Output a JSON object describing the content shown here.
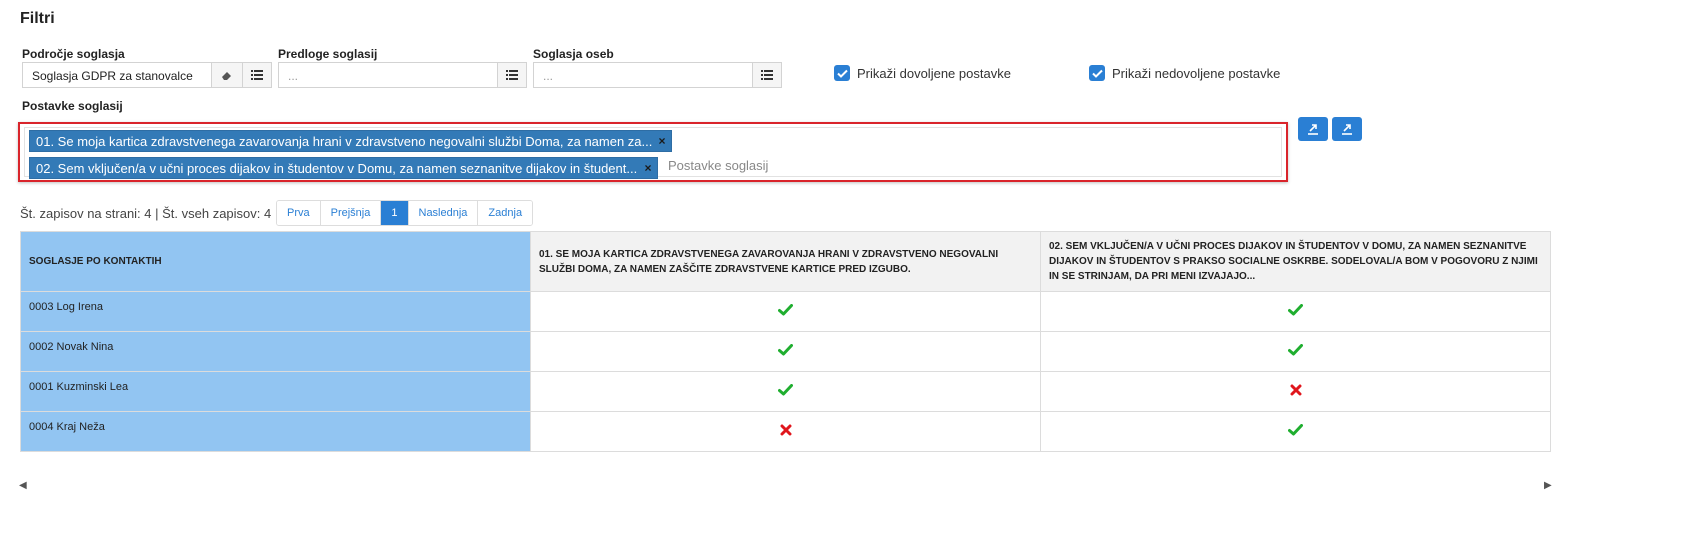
{
  "page_title": "Filtri",
  "filters": {
    "area": {
      "label": "Področje soglasja",
      "value": "Soglasja GDPR za stanovalce"
    },
    "templates": {
      "label": "Predloge soglasij",
      "placeholder": "..."
    },
    "persons": {
      "label": "Soglasja oseb",
      "placeholder": "..."
    },
    "show_allowed": {
      "label": "Prikaži dovoljene postavke",
      "checked": true
    },
    "show_disallowed": {
      "label": "Prikaži nedovoljene postavke",
      "checked": true
    }
  },
  "items": {
    "label": "Postavke soglasij",
    "tags": [
      "01. Se moja kartica zdravstvenega zavarovanja hrani v zdravstveno negovalni službi Doma, za namen za...",
      "02. Sem vključen/a v učni proces dijakov in študentov v Domu, za namen seznanitve dijakov in študent..."
    ],
    "placeholder": "Postavke soglasij"
  },
  "records_info": "Št. zapisov na strani: 4 | Št. vseh zapisov: 4",
  "pagination": {
    "first": "Prva",
    "prev": "Prejšnja",
    "current": "1",
    "next": "Naslednja",
    "last": "Zadnja"
  },
  "table": {
    "columns": [
      "SOGLASJE PO KONTAKTIH",
      "01. SE MOJA KARTICA ZDRAVSTVENEGA ZAVAROVANJA HRANI V ZDRAVSTVENO NEGOVALNI SLUŽBI DOMA, ZA NAMEN ZAŠČITE ZDRAVSTVENE KARTICE PRED IZGUBO.",
      "02. SEM VKLJUČEN/A V UČNI PROCES DIJAKOV IN ŠTUDENTOV V DOMU, ZA NAMEN SEZNANITVE DIJAKOV IN ŠTUDENTOV S PRAKSO SOCIALNE OSKRBE. SODELOVAL/A BOM V POGOVORU Z NJIMI IN SE STRINJAM, DA PRI MENI IZVAJAJO..."
    ],
    "rows": [
      {
        "name": "0003 Log Irena",
        "c1": true,
        "c2": true
      },
      {
        "name": "0002 Novak Nina",
        "c1": true,
        "c2": true
      },
      {
        "name": "0001 Kuzminski Lea",
        "c1": true,
        "c2": false
      },
      {
        "name": "0004 Kraj Neža",
        "c1": false,
        "c2": true
      }
    ]
  },
  "colors": {
    "accent": "#2a7fd4",
    "highlight": "#92c5f2",
    "allowed": "#1fae2f",
    "denied": "#e0161c",
    "focus_border": "#d9242b"
  },
  "icons": {
    "check": "check-icon",
    "cross": "cross-icon",
    "eraser": "eraser-icon",
    "list": "list-icon",
    "export": "export-icon"
  }
}
